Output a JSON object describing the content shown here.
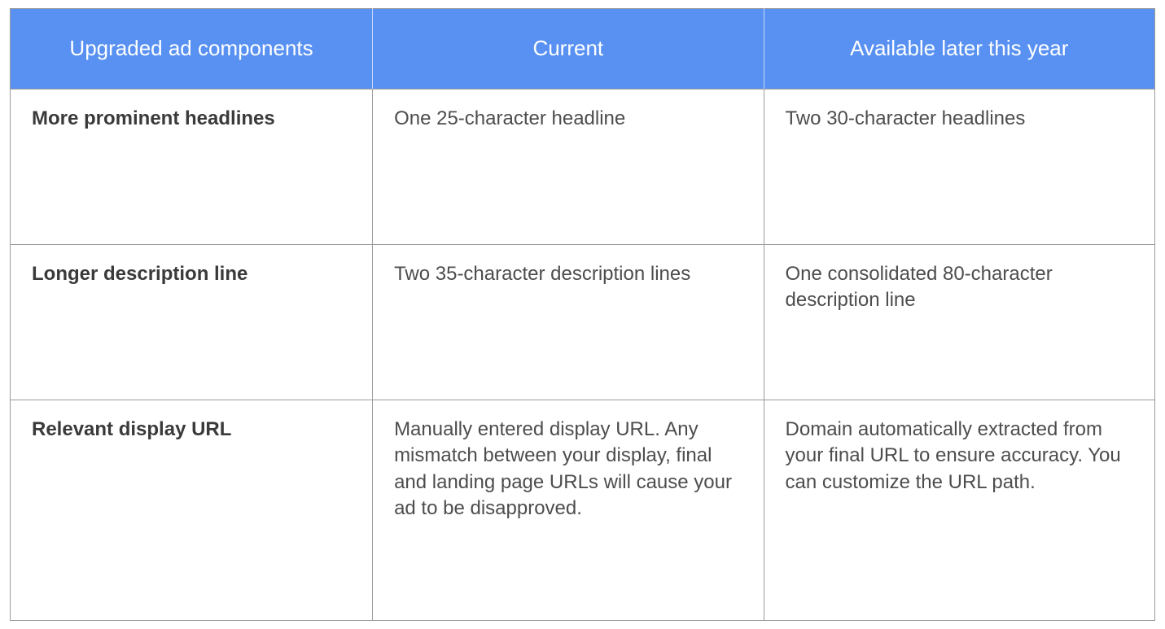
{
  "table": {
    "headers": {
      "c1": "Upgraded ad components",
      "c2": "Current",
      "c3": "Available later this year"
    },
    "rows": [
      {
        "component": "More prominent headlines",
        "current": "One 25-character headline",
        "later": "Two 30-character headlines"
      },
      {
        "component": "Longer description line",
        "current": "Two 35-character description lines",
        "later": "One consolidated 80-character description line"
      },
      {
        "component": "Relevant display URL",
        "current": "Manually entered display URL. Any mismatch between your display, final and landing page URLs will cause your ad to be disapproved.",
        "later": "Domain automatically extracted from your final URL to ensure accuracy. You can customize the URL path."
      }
    ]
  }
}
